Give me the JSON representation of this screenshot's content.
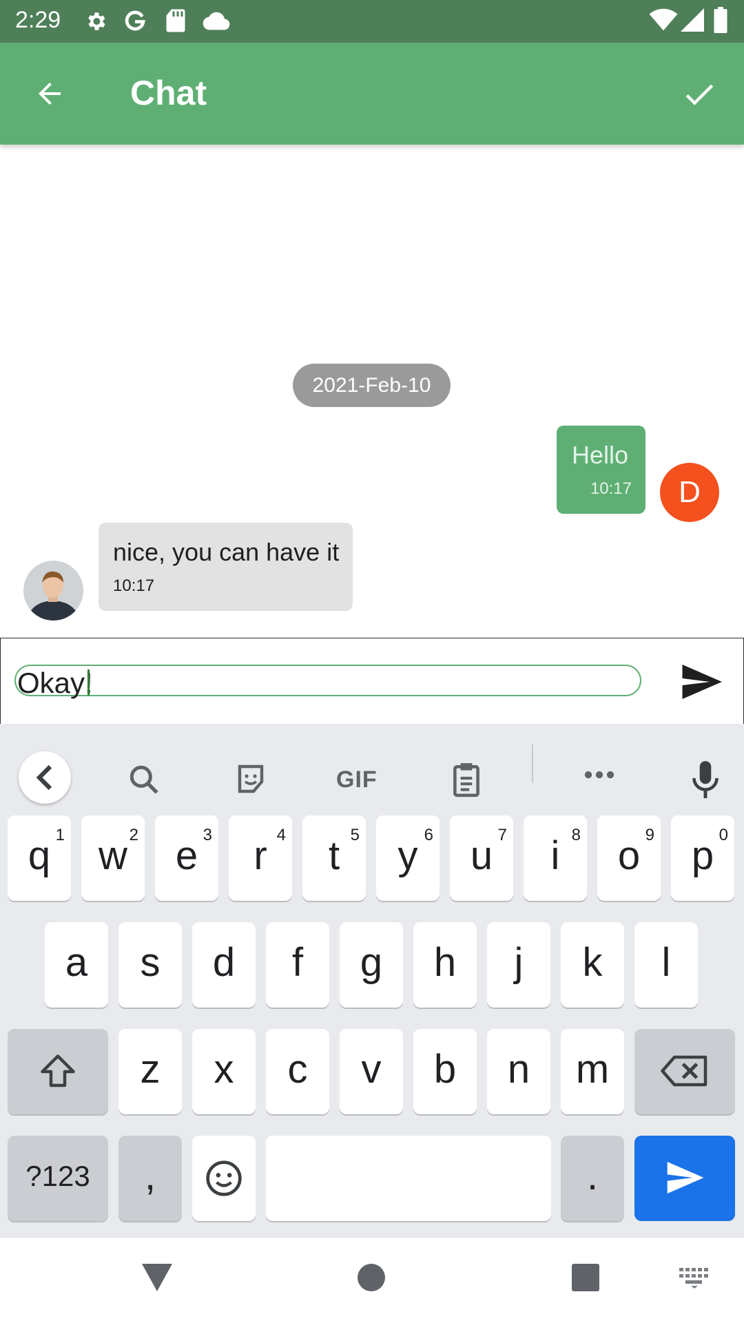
{
  "status_bar": {
    "time": "2:29",
    "icons": [
      "settings-icon",
      "google-icon",
      "sd-card-icon",
      "cloud-icon",
      "wifi-icon",
      "signal-icon",
      "battery-icon"
    ]
  },
  "app_bar": {
    "title": "Chat",
    "back_icon": "arrow-back-icon",
    "confirm_icon": "check-icon",
    "color": "#5faf74"
  },
  "chat": {
    "date_separator": "2021-Feb-10",
    "messages": [
      {
        "direction": "outgoing",
        "text": "Hello",
        "time": "10:17",
        "avatar_letter": "D",
        "avatar_color": "#f4511e"
      },
      {
        "direction": "incoming",
        "text": "nice, you can have it",
        "time": "10:17",
        "avatar": "profile-photo"
      }
    ]
  },
  "composer": {
    "value": "Okay!",
    "send_icon": "send-icon"
  },
  "keyboard": {
    "toolbar": [
      "chevron-left-icon",
      "search-icon",
      "sticker-icon",
      "GIF",
      "clipboard-icon",
      "more-icon",
      "mic-icon"
    ],
    "row1": [
      {
        "k": "q",
        "n": "1"
      },
      {
        "k": "w",
        "n": "2"
      },
      {
        "k": "e",
        "n": "3"
      },
      {
        "k": "r",
        "n": "4"
      },
      {
        "k": "t",
        "n": "5"
      },
      {
        "k": "y",
        "n": "6"
      },
      {
        "k": "u",
        "n": "7"
      },
      {
        "k": "i",
        "n": "8"
      },
      {
        "k": "o",
        "n": "9"
      },
      {
        "k": "p",
        "n": "0"
      }
    ],
    "row2": [
      "a",
      "s",
      "d",
      "f",
      "g",
      "h",
      "j",
      "k",
      "l"
    ],
    "row3": [
      "z",
      "x",
      "c",
      "v",
      "b",
      "n",
      "m"
    ],
    "symbols_label": "?123",
    "comma": ",",
    "period": ".",
    "accent": "#1a73e8"
  },
  "nav_bar": {
    "icons": [
      "back-triangle-icon",
      "home-circle-icon",
      "recents-square-icon",
      "keyboard-switch-icon"
    ]
  }
}
